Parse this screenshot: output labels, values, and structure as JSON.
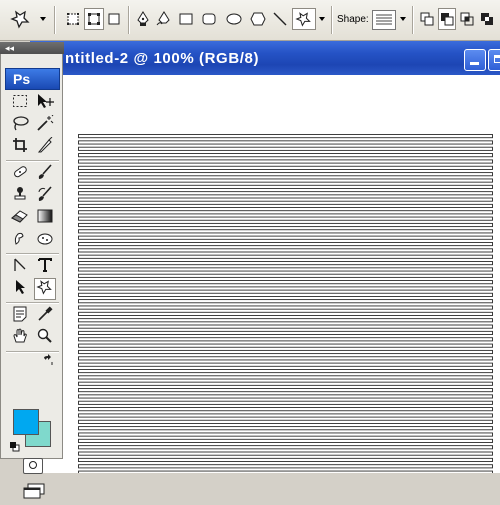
{
  "document": {
    "title": "ntitled-2 @ 100% (RGB/8)",
    "minimize_icon": "minimize-icon",
    "maximize_icon": "maximize-icon"
  },
  "options_bar": {
    "shape_label": "Shape:",
    "icons": [
      "custom-shape-preset-icon",
      "shape-layers-icon",
      "paths-icon",
      "fill-pixels-icon",
      "pen-icon",
      "freeform-pen-icon",
      "rectangle-icon",
      "rounded-rectangle-icon",
      "ellipse-icon",
      "polygon-icon",
      "line-icon",
      "custom-shape-icon",
      "combine-add-icon",
      "combine-subtract-icon",
      "combine-intersect-icon",
      "combine-exclude-icon"
    ]
  },
  "toolbox": {
    "logo": "Ps",
    "collapse_glyph": "◂◂",
    "tools": [
      "marquee-icon",
      "move-icon",
      "lasso-icon",
      "magic-wand-icon",
      "crop-icon",
      "slice-icon",
      "healing-brush-icon",
      "brush-icon",
      "clone-stamp-icon",
      "history-brush-icon",
      "eraser-icon",
      "gradient-icon",
      "dodge-icon",
      "burn-sponge-icon",
      "path-selection-icon",
      "type-icon",
      "direct-selection-icon",
      "custom-shape-tool-icon",
      "notes-icon",
      "eyedropper-icon",
      "hand-icon",
      "zoom-icon"
    ],
    "colors": {
      "foreground": "#00a8f0",
      "background": "#7fd9cc"
    }
  },
  "colors": {
    "title_bar": "#2553c6",
    "stripe": "#2a2a2a"
  }
}
